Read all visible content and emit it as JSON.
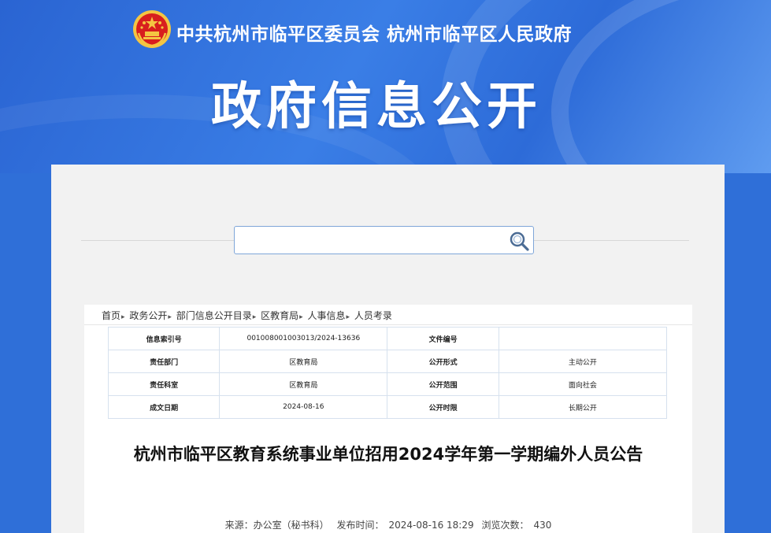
{
  "header": {
    "org_title": "中共杭州市临平区委员会  杭州市临平区人民政府",
    "hero_title": "政府信息公开",
    "emblem_icon": "national-emblem-icon"
  },
  "search": {
    "placeholder": "",
    "value": "",
    "icon": "search-icon"
  },
  "breadcrumb": {
    "items": [
      "首页",
      "政务公开",
      "部门信息公开目录",
      "区教育局",
      "人事信息",
      "人员考录"
    ],
    "separator": "▸"
  },
  "meta_table": {
    "rows": [
      {
        "k1": "信息索引号",
        "v1": "001008001003013/2024-13636",
        "k2": "文件编号",
        "v2": ""
      },
      {
        "k1": "责任部门",
        "v1": "区教育局",
        "k2": "公开形式",
        "v2": "主动公开"
      },
      {
        "k1": "责任科室",
        "v1": "区教育局",
        "k2": "公开范围",
        "v2": "面向社会"
      },
      {
        "k1": "成文日期",
        "v1": "2024-08-16",
        "k2": "公开时限",
        "v2": "长期公开"
      }
    ]
  },
  "article": {
    "title": "杭州市临平区教育系统事业单位招用2024学年第一学期编外人员公告",
    "source_label": "来源：办公室（秘书科）",
    "date_label": "发布时间：",
    "date": "2024-08-16 18:29",
    "views_label": "浏览次数：",
    "views": "430"
  },
  "colors": {
    "banner_blue": "#2f6fd8",
    "panel_gray": "#f2f2f2",
    "search_border": "#7fa6d9",
    "table_border": "#d6e1ee"
  }
}
